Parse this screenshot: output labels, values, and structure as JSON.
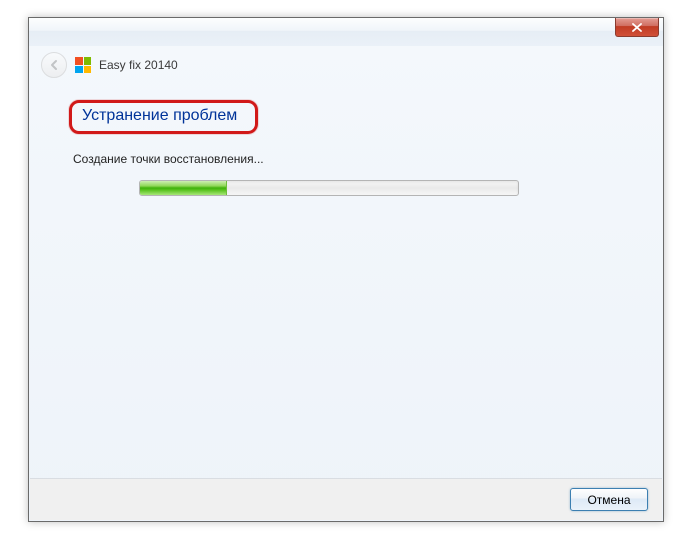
{
  "window": {
    "title": "Easy fix 20140"
  },
  "main": {
    "heading": "Устранение проблем",
    "status": "Создание точки восстановления...",
    "progress_percent": 23
  },
  "footer": {
    "cancel_label": "Отмена"
  }
}
